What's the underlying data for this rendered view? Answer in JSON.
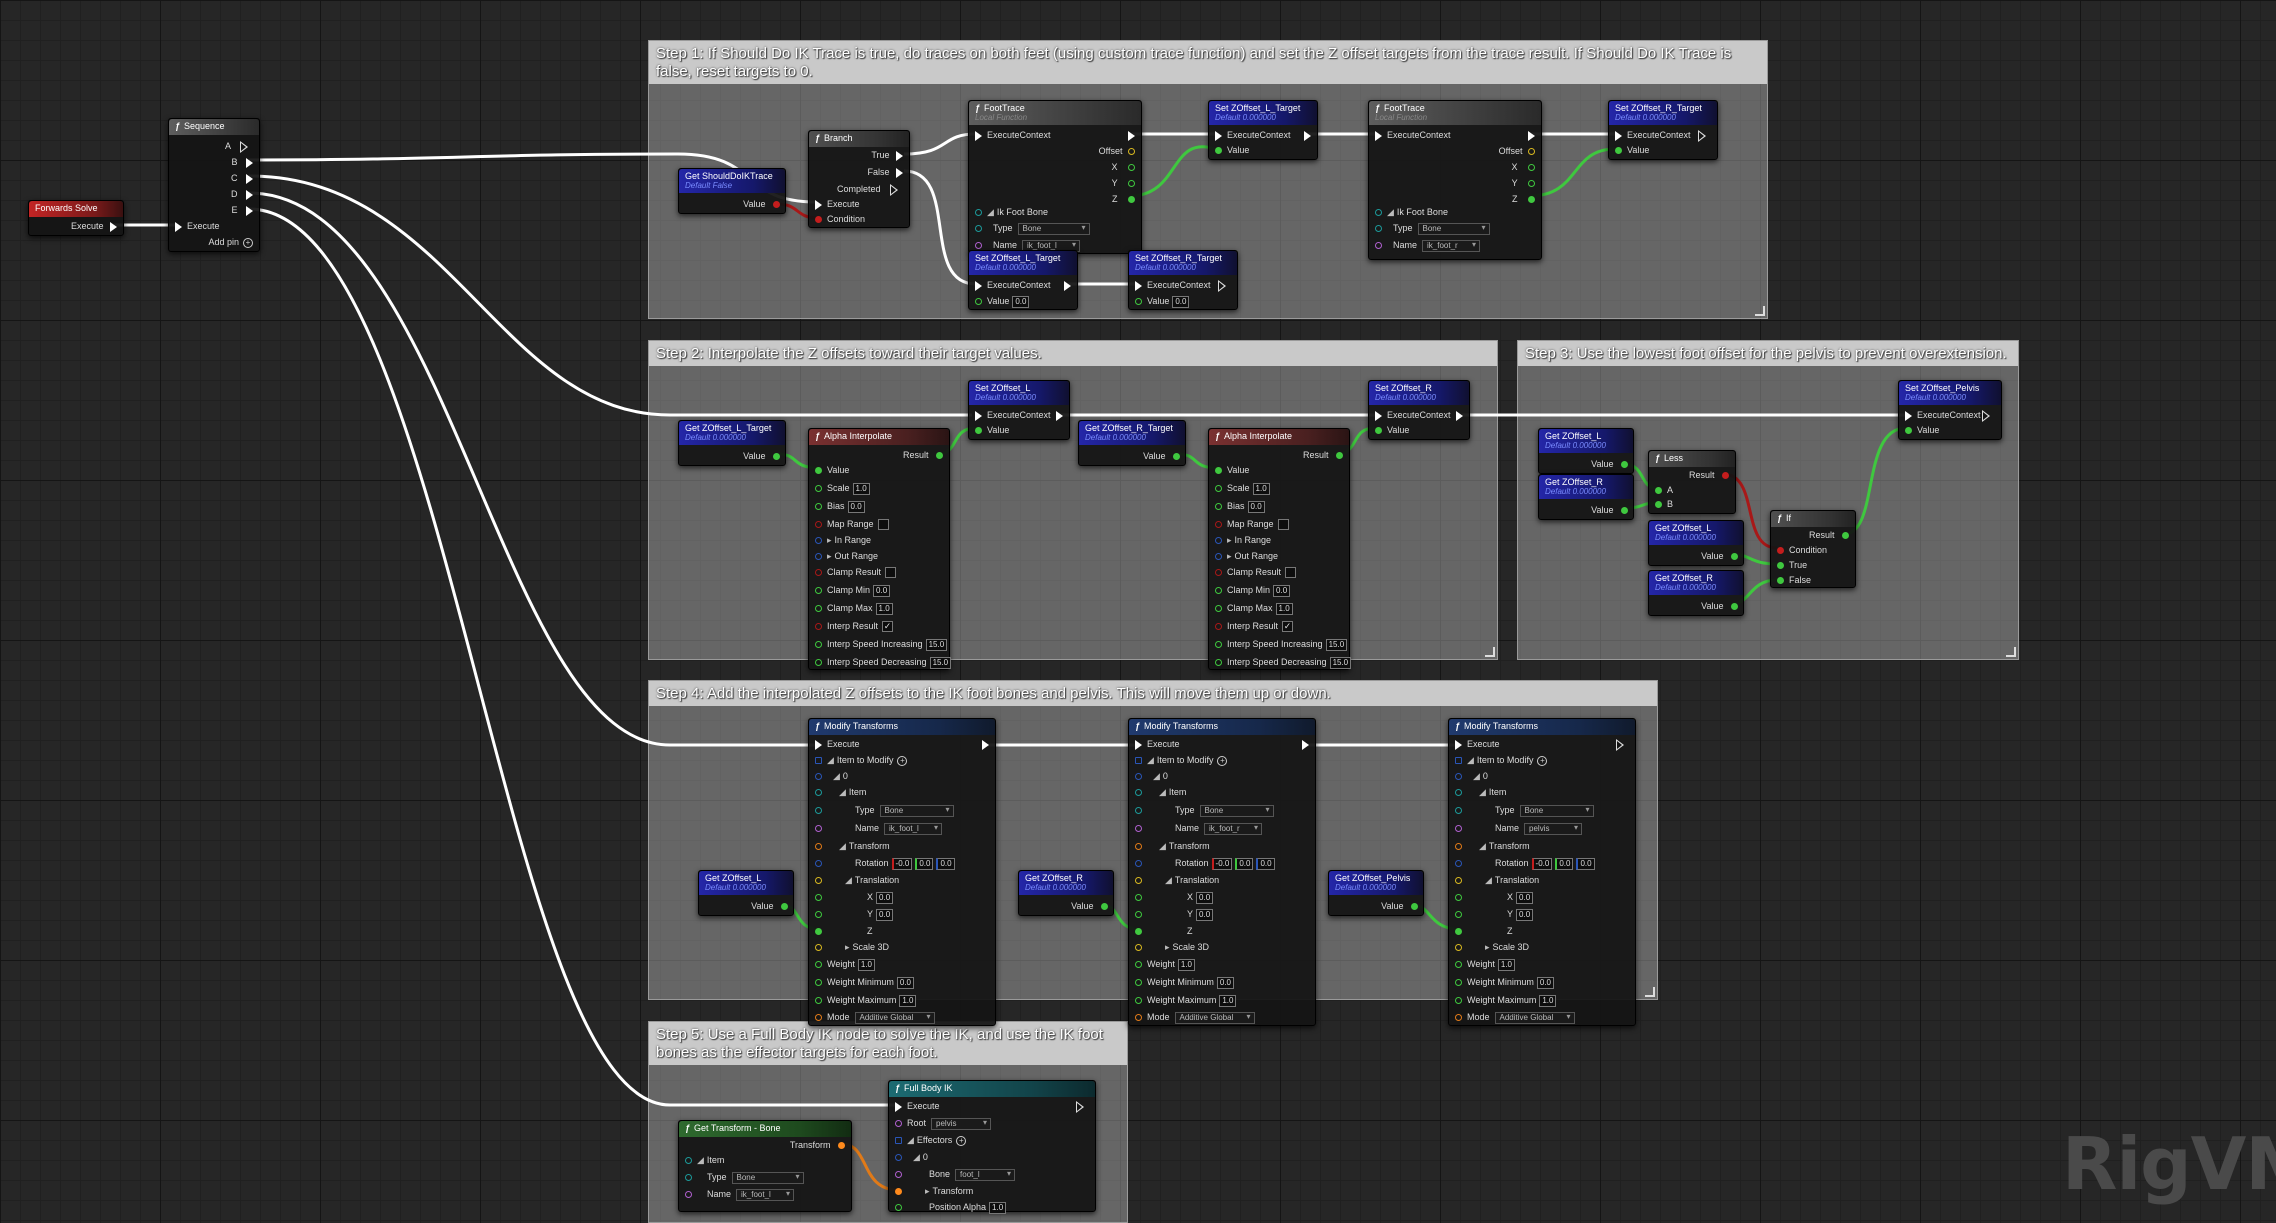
{
  "watermark": "RigVM",
  "comments": {
    "step1": "Step 1: If Should Do IK Trace is true, do traces on both feet (using custom trace function) and set the Z offset targets from the trace result. If Should Do IK Trace is false, reset targets to 0.",
    "step2": "Step 2: Interpolate the Z offsets toward their target values.",
    "step3": "Step 3: Use the lowest foot offset for the pelvis to prevent overextension.",
    "step4": "Step 4: Add the interpolated Z offsets to the IK foot bones and pelvis. This will move them up or down.",
    "step5": "Step 5: Use a Full Body IK node to solve the IK, and use the IK foot bones as the effector targets for each foot."
  },
  "forwards_solve": {
    "title": "Forwards Solve",
    "execute": "Execute"
  },
  "sequence": {
    "title": "Sequence",
    "execute": "Execute",
    "pins": [
      "A",
      "B",
      "C",
      "D",
      "E"
    ],
    "add_pin": "Add pin"
  },
  "get_should_do": {
    "title": "Get ShouldDoIKTrace",
    "default": "Default False",
    "value": "Value"
  },
  "branch": {
    "title": "Branch",
    "true": "True",
    "false": "False",
    "completed": "Completed",
    "execute": "Execute",
    "condition": "Condition"
  },
  "footrace": {
    "title": "FootTrace",
    "subtitle": "Local Function",
    "execute_context": "ExecuteContext",
    "offset": "Offset",
    "x": "X",
    "y": "Y",
    "z": "Z",
    "ik_foot_bone": "Ik Foot Bone",
    "type_label": "Type",
    "type_value": "Bone",
    "name_label": "Name",
    "name_l": "ik_foot_l",
    "name_r": "ik_foot_r"
  },
  "set_nodes": {
    "zoffset_l_target": "Set ZOffset_L_Target",
    "zoffset_r_target": "Set ZOffset_R_Target",
    "zoffset_l": "Set ZOffset_L",
    "zoffset_r": "Set ZOffset_R",
    "zoffset_pelvis": "Set ZOffset_Pelvis",
    "default": "Default 0.000000",
    "execute_context": "ExecuteContext",
    "value": "Value",
    "zero": "0.0"
  },
  "get_nodes": {
    "zoffset_l_target": "Get ZOffset_L_Target",
    "zoffset_r_target": "Get ZOffset_R_Target",
    "zoffset_l": "Get ZOffset_L",
    "zoffset_r": "Get ZOffset_R",
    "zoffset_pelvis": "Get ZOffset_Pelvis",
    "default": "Default 0.000000",
    "value": "Value"
  },
  "alpha_interp": {
    "title": "Alpha Interpolate",
    "result": "Result",
    "value": "Value",
    "scale": "Scale",
    "scale_v": "1.0",
    "bias": "Bias",
    "bias_v": "0.0",
    "map_range": "Map Range",
    "in_range": "In Range",
    "out_range": "Out Range",
    "clamp_result": "Clamp Result",
    "clamp_min": "Clamp Min",
    "clamp_min_v": "0.0",
    "clamp_max": "Clamp Max",
    "clamp_max_v": "1.0",
    "interp_result": "Interp Result",
    "speed_inc": "Interp Speed Increasing",
    "speed_inc_v": "15.0",
    "speed_dec": "Interp Speed Decreasing",
    "speed_dec_v": "15.0"
  },
  "less": {
    "title": "Less",
    "result": "Result",
    "a": "A",
    "b": "B"
  },
  "if_node": {
    "title": "If",
    "result": "Result",
    "condition": "Condition",
    "true": "True",
    "false": "False"
  },
  "modify": {
    "title": "Modify Transforms",
    "execute": "Execute",
    "items": "Item to Modify",
    "idx": "0",
    "item": "Item",
    "type": "Type",
    "type_v": "Bone",
    "name": "Name",
    "names": [
      "ik_foot_l",
      "ik_foot_r",
      "pelvis"
    ],
    "transform": "Transform",
    "rotation": "Rotation",
    "rot_v": [
      "-0.0",
      "0.0",
      "0.0"
    ],
    "translation": "Translation",
    "x": "X",
    "y": "Y",
    "z": "Z",
    "zero": "0.0",
    "scale3d": "Scale 3D",
    "weight": "Weight",
    "weight_v": "1.0",
    "wmin": "Weight Minimum",
    "wmin_v": "0.0",
    "wmax": "Weight Maximum",
    "wmax_v": "1.0",
    "mode": "Mode",
    "mode_v": "Additive Global"
  },
  "fullbody": {
    "title": "Full Body IK",
    "execute": "Execute",
    "root": "Root",
    "root_v": "pelvis",
    "effectors": "Effectors",
    "idx": "0",
    "bone": "Bone",
    "bone_v": "foot_l",
    "transform": "Transform",
    "pos_alpha": "Position Alpha",
    "pos_alpha_v": "1.0"
  },
  "get_transform": {
    "title": "Get Transform - Bone",
    "transform": "Transform",
    "item": "Item",
    "type": "Type",
    "type_v": "Bone",
    "name": "Name",
    "name_v": "ik_foot_l"
  },
  "colors": {
    "exec_wire": "#ffffff",
    "float_wire": "#3fc83f",
    "bool_wire": "#a81818",
    "transform_wire": "#e07a18"
  }
}
